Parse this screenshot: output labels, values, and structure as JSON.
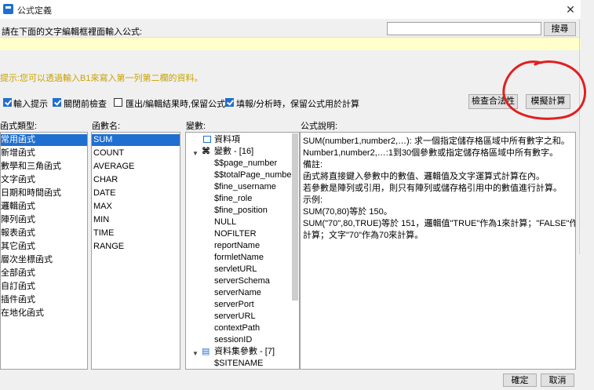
{
  "window": {
    "title": "公式定義",
    "close_label": "✕"
  },
  "instruction": "請在下面的文字編輯框裡面輸入公式:",
  "search": {
    "value": "",
    "button_label": "搜尋"
  },
  "formula": {
    "value": ""
  },
  "hint": "提示:您可以透過輸入B1來寫入第一列第二欄的資料。",
  "options": [
    {
      "label": "輸入提示",
      "checked": true
    },
    {
      "label": "關閉前檢查",
      "checked": true
    },
    {
      "label": "匯出/編輯結果時,保留公式",
      "checked": false
    },
    {
      "label": "填報/分析時，保留公式用於計算",
      "checked": true
    }
  ],
  "buttons": {
    "check": "檢查合法性",
    "simulate": "模擬計算",
    "ok": "確定",
    "cancel": "取消"
  },
  "headers": {
    "category": "函式類型:",
    "function": "函數名:",
    "variable": "變數:",
    "description": "公式說明:"
  },
  "categories": [
    "常用函式",
    "新增函式",
    "數學和三角函式",
    "文字函式",
    "日期和時間函式",
    "邏輯函式",
    "陣列函式",
    "報表函式",
    "其它函式",
    "層次坐標函式",
    "全部函式",
    "自訂函式",
    "插件函式",
    "在地化函式"
  ],
  "functions": [
    "SUM",
    "COUNT",
    "AVERAGE",
    "CHAR",
    "DATE",
    "MAX",
    "MIN",
    "TIME",
    "RANGE"
  ],
  "variables": {
    "data_item": "資料項",
    "var_group": "變數 - [16]",
    "var_items": [
      "$$page_number",
      "$$totalPage_number",
      "$fine_username",
      "$fine_role",
      "$fine_position",
      "NULL",
      "NOFILTER",
      "reportName",
      "formletName",
      "servletURL",
      "serverSchema",
      "serverName",
      "serverPort",
      "serverURL",
      "contextPath",
      "sessionID"
    ],
    "ds_group": "資料集參數 - [7]",
    "ds_items": [
      "$SITENAME"
    ]
  },
  "description": [
    "SUM(number1,number2,…): 求一個指定儲存格區域中所有數字之和。",
    "Number1,number2,…:1到30個參數或指定儲存格區域中所有數字。",
    "備註:",
    "函式將直接鍵入參數中的數值、邏輯值及文字運算式計算在內。",
    "若參數是陣列或引用，則只有陣列或儲存格引用中的數值進行計算。",
    "示例:",
    "SUM(70,80)等於 150。",
    "SUM(\"70\",80,TRUE)等於 151，邏輯值\"TRUE\"作為1來計算；\"FALSE\"作為0",
    "計算；文字\"70\"作為70來計算。"
  ],
  "colors": {
    "accent": "#1f6fd0",
    "hint": "#c9a200",
    "formula_bg": "#ffffcc",
    "annotation": "#e02020"
  }
}
